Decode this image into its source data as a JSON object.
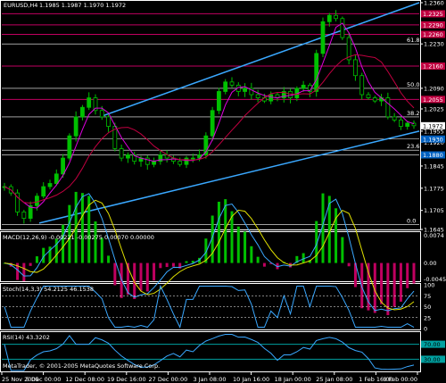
{
  "header": {
    "symbol": "EURUSD,H4",
    "ohlc": "1.1985 1.1987 1.1970 1.1972"
  },
  "copyright": "MetaTrader, © 2001-2005 MetaQuotes Software Corp.",
  "colors": {
    "bull_candle": "#00c000",
    "bear_candle": "#00c000",
    "channel": "#3aa8ff",
    "ma_fast": "#e000e0",
    "ma_slow": "#c00040",
    "level_line": "#c00060",
    "fib_line": "#ffffff",
    "macd_pos": "#00c000",
    "macd_neg": "#c00060",
    "macd_signal": "#e0e000",
    "macd_main": "#3aa8ff",
    "stoch_main": "#3aa8ff",
    "rsi_main": "#3aa8ff",
    "rsi_levels": "#00a0a0",
    "price_tag_red": "#c00040",
    "price_tag_blue": "#0060c0",
    "price_tag_current": "#ffffff"
  },
  "chart_data": {
    "type": "candlestick",
    "main": {
      "y_ticks": [
        "1.2360",
        "1.2325",
        "1.2290",
        "1.2255",
        "1.2230",
        "1.2195",
        "1.2160",
        "1.2125",
        "1.2090",
        "1.2055",
        "1.2025",
        "1.1990",
        "1.1955",
        "1.1920",
        "1.1880",
        "1.1845",
        "1.1810",
        "1.1775",
        "1.1740",
        "1.1705",
        "1.1645"
      ],
      "y_labels_shown": [
        "1.2360",
        "1.2325",
        "1.2290",
        "1.2230",
        "1.2160",
        "1.2090",
        "1.2055",
        "1.2025",
        "1.1972",
        "1.1955",
        "1.1920",
        "1.1880",
        "1.1845",
        "1.1775",
        "1.1705",
        "1.1645"
      ],
      "price_tags": [
        {
          "label": "1.2325",
          "style": "red"
        },
        {
          "label": "1.2290",
          "style": "red"
        },
        {
          "label": "1.2260",
          "style": "red"
        },
        {
          "label": "1.2160",
          "style": "red"
        },
        {
          "label": "1.2055",
          "style": "red"
        },
        {
          "label": "1.1972",
          "style": "current"
        },
        {
          "label": "1.1930",
          "style": "blue"
        },
        {
          "label": "1.1880",
          "style": "blue"
        }
      ],
      "fib_labels": [
        "61.8",
        "50.0",
        "38.2",
        "23.6",
        "0.0"
      ],
      "ylim": [
        1.1645,
        1.236
      ],
      "close_series": [
        1.178,
        1.176,
        1.17,
        1.168,
        1.172,
        1.175,
        1.178,
        1.179,
        1.182,
        1.187,
        1.194,
        1.2,
        1.203,
        1.206,
        1.202,
        1.2,
        1.197,
        1.19,
        1.187,
        1.188,
        1.186,
        1.187,
        1.185,
        1.186,
        1.188,
        1.187,
        1.186,
        1.185,
        1.187,
        1.187,
        1.188,
        1.194,
        1.202,
        1.208,
        1.211,
        1.21,
        1.208,
        1.209,
        1.207,
        1.206,
        1.205,
        1.207,
        1.206,
        1.208,
        1.206,
        1.209,
        1.21,
        1.208,
        1.22,
        1.23,
        1.232,
        1.231,
        1.225,
        1.218,
        1.213,
        1.207,
        1.206,
        1.205,
        1.206,
        1.2,
        1.199,
        1.197,
        1.198,
        1.1972
      ]
    },
    "macd": {
      "label": "MACD(12,26,9) -0.00221 -0.00275 0.00070 0.00000",
      "y_labels": [
        "0.0074",
        "0.00",
        "-0.0045"
      ],
      "ylim": [
        -0.0045,
        0.0074
      ]
    },
    "stoch": {
      "label": "Stoch(14,3,3) 54.2125 46.1538",
      "y_labels": [
        "100",
        "75",
        "50",
        "25",
        "0"
      ],
      "levels": [
        75,
        50,
        25
      ],
      "ylim": [
        0,
        100
      ]
    },
    "rsi": {
      "label": "RSI(14) 43.3202",
      "y_labels": [
        "70.00",
        "30.00"
      ],
      "levels": [
        70,
        30
      ],
      "ylim": [
        0,
        100
      ]
    },
    "x_labels": [
      "25 Nov 2005",
      "5 Dec 00:00",
      "12 Dec 08:00",
      "19 Dec 16:00",
      "27 Dec 00:00",
      "3 Jan 08:00",
      "10 Jan 16:00",
      "18 Jan 00:00",
      "25 Jan 08:00",
      "1 Feb 16:00",
      "9 Feb 00:00"
    ]
  }
}
